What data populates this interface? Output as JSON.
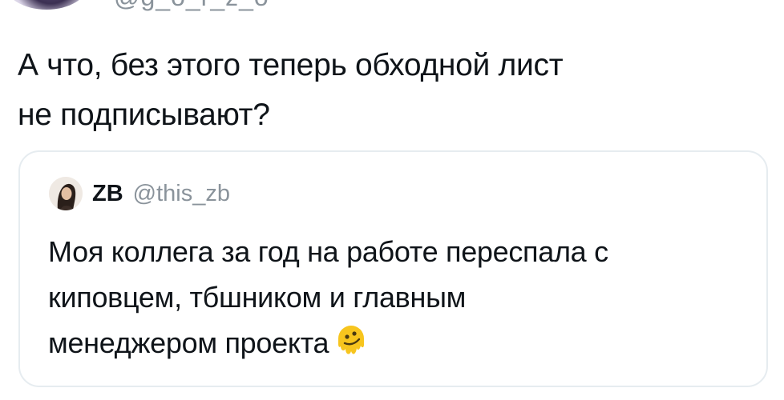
{
  "main_tweet": {
    "handle_partial": "@g_o_r_z_o",
    "text_line_1": "А что, без этого теперь обходной лист",
    "text_line_2": "не подписывают?"
  },
  "quoted_tweet": {
    "author_name": "ZB",
    "author_handle": "@this_zb",
    "text_line_1": "Моя коллега за год на работе переспала с",
    "text_line_2": "киповцем, тбшником и главным",
    "text_line_3": "менеджером проекта",
    "emoji": "melting-face-emoji"
  },
  "colors": {
    "text": "#0f1419",
    "secondary_text": "#8a939b",
    "card_border": "#e6ecf0",
    "emoji_yellow": "#f7c51e"
  }
}
